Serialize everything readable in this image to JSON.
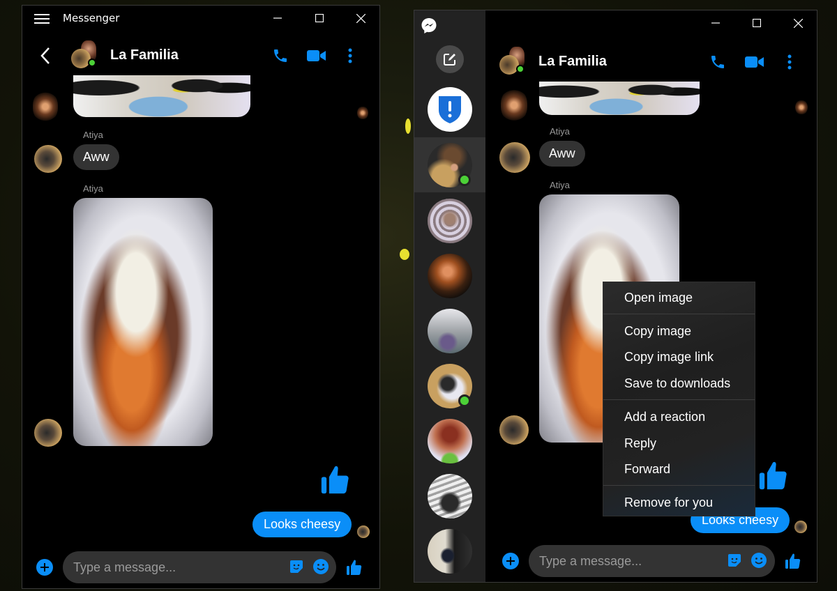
{
  "windows": [
    {
      "app_title": "Messenger",
      "conversation": {
        "title": "La Familia",
        "messages": [
          {
            "type": "image",
            "description": "cat photo"
          },
          {
            "type": "text",
            "sender": "Atiya",
            "text": "Aww"
          },
          {
            "type": "image",
            "sender": "Atiya",
            "description": "baked sweet potato with cheese"
          },
          {
            "type": "like",
            "from": "me"
          },
          {
            "type": "text",
            "from": "me",
            "text": "Looks cheesy"
          }
        ]
      },
      "composer": {
        "placeholder": "Type a message..."
      }
    },
    {
      "conversation": {
        "title": "La Familia",
        "messages": [
          {
            "type": "image",
            "description": "cat photo"
          },
          {
            "type": "text",
            "sender": "Atiya",
            "text": "Aww"
          },
          {
            "type": "image",
            "sender": "Atiya",
            "description": "baked sweet potato with cheese"
          },
          {
            "type": "like",
            "from": "me"
          },
          {
            "type": "text",
            "from": "me",
            "text": "Looks cheesy"
          }
        ]
      },
      "composer": {
        "placeholder": "Type a message..."
      },
      "sidebar": {
        "items": [
          {
            "name": "security-alert",
            "active": false,
            "online": false
          },
          {
            "name": "la-familia",
            "active": true,
            "online": true
          },
          {
            "name": "chat-2",
            "active": false,
            "online": false
          },
          {
            "name": "chat-3",
            "active": false,
            "online": false
          },
          {
            "name": "chat-4",
            "active": false,
            "online": false
          },
          {
            "name": "chat-5",
            "active": false,
            "online": true
          },
          {
            "name": "chat-6",
            "active": false,
            "online": false
          },
          {
            "name": "chat-7",
            "active": false,
            "online": false
          },
          {
            "name": "chat-8",
            "active": false,
            "online": false
          }
        ]
      }
    }
  ],
  "context_menu": {
    "groups": [
      [
        "Open image"
      ],
      [
        "Copy image",
        "Copy image link",
        "Save to downloads"
      ],
      [
        "Add a reaction",
        "Reply",
        "Forward"
      ],
      [
        "Remove for you"
      ]
    ],
    "items": {
      "open_image": "Open image",
      "copy_image": "Copy image",
      "copy_image_link": "Copy image link",
      "save_to_downloads": "Save to downloads",
      "add_reaction": "Add a reaction",
      "reply": "Reply",
      "forward": "Forward",
      "remove_for_you": "Remove for you"
    }
  },
  "colors": {
    "accent": "#0a8ef8",
    "online": "#4cd137",
    "incoming_bubble": "#333333",
    "window_bg": "#000000",
    "sidebar_bg": "#222222"
  }
}
